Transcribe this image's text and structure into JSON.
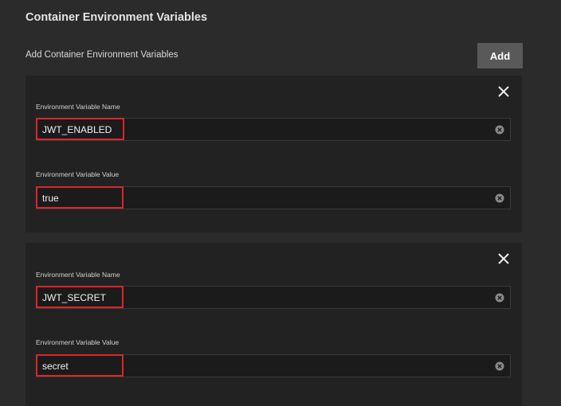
{
  "section": {
    "title": "Container Environment Variables",
    "subtitle": "Add Container Environment Variables",
    "add_label": "Add"
  },
  "variables": [
    {
      "name_label": "Environment Variable Name",
      "name_value": "JWT_ENABLED",
      "value_label": "Environment Variable Value",
      "value_value": "true"
    },
    {
      "name_label": "Environment Variable Name",
      "name_value": "JWT_SECRET",
      "value_label": "Environment Variable Value",
      "value_value": "secret"
    }
  ],
  "icons": {
    "remove": "close-icon",
    "clear": "clear-circle-icon"
  },
  "colors": {
    "background": "#2b2b2b",
    "card": "#222222",
    "field": "#1b1b1b",
    "add_button": "#595959",
    "highlight": "#d9262b"
  }
}
